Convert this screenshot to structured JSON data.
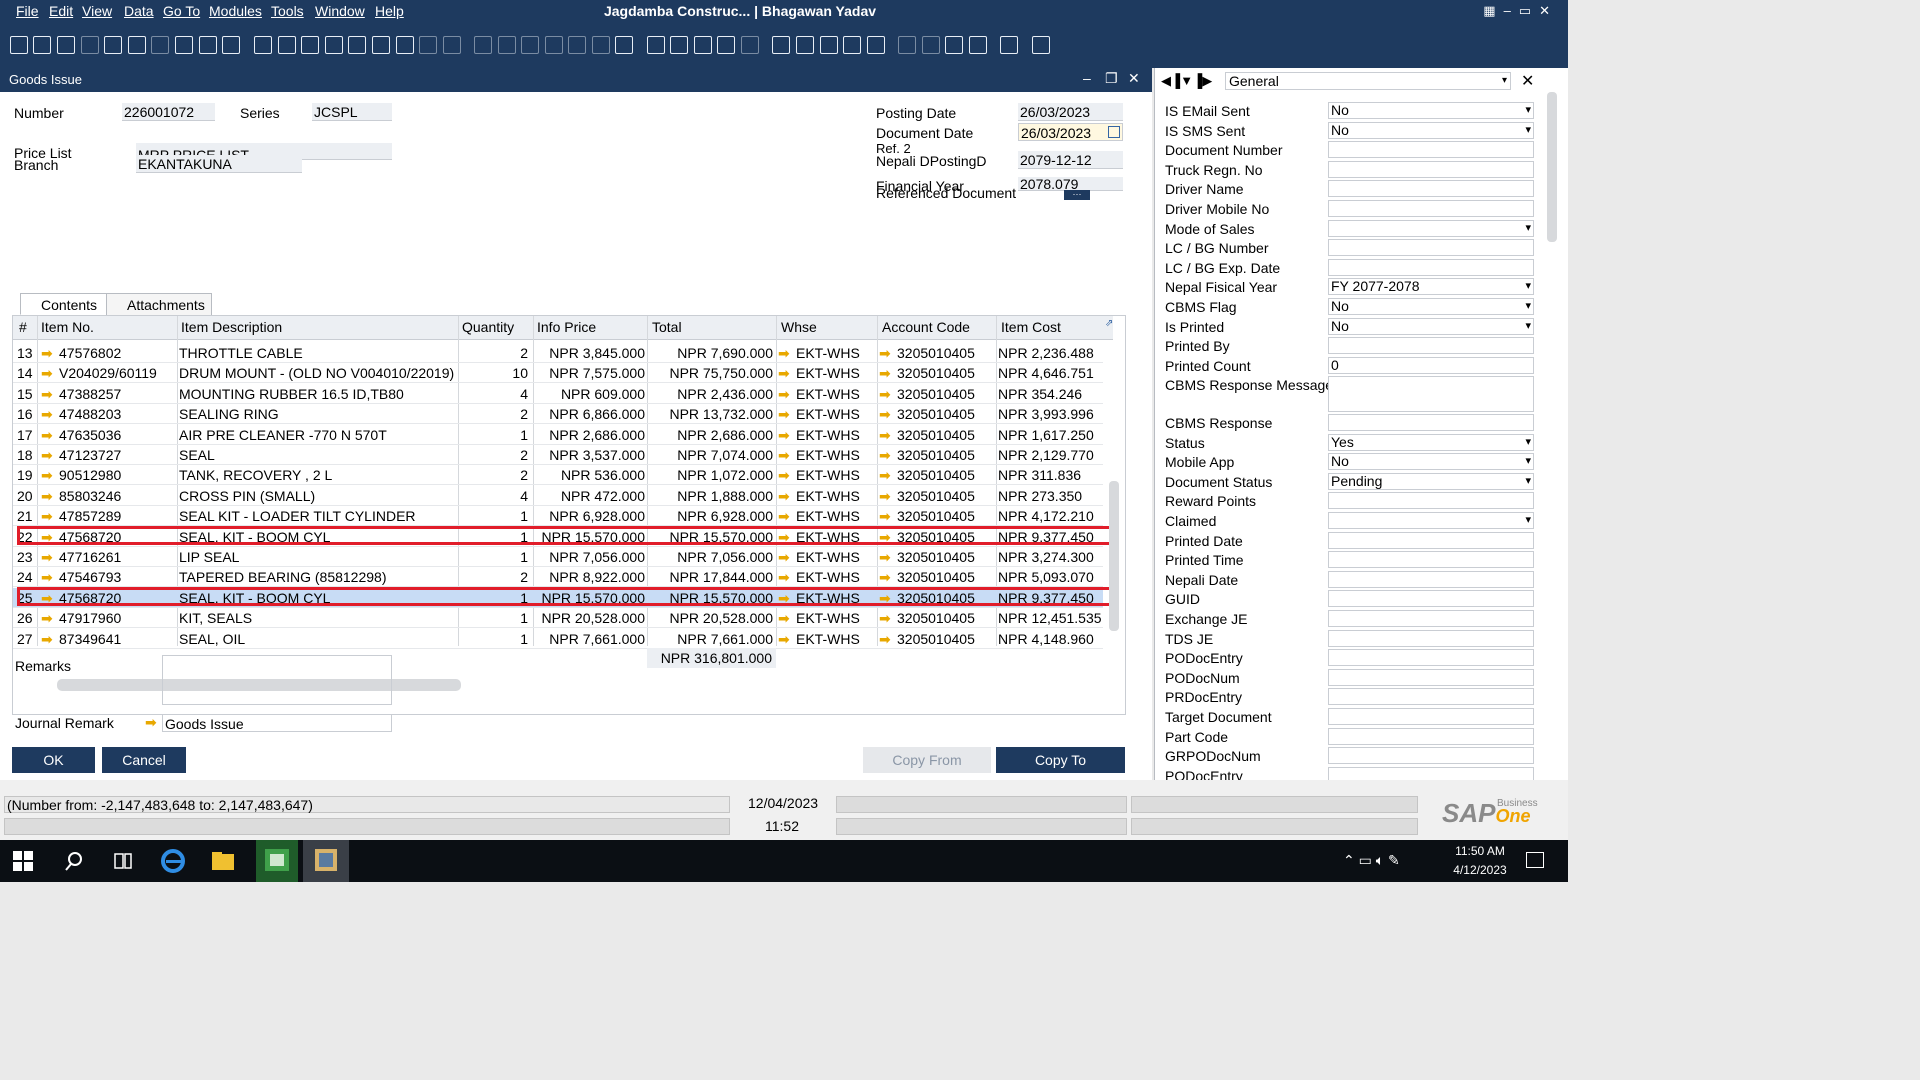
{
  "menu": [
    "File",
    "Edit",
    "View",
    "Data",
    "Go To",
    "Modules",
    "Tools",
    "Window",
    "Help"
  ],
  "app_title": "Jagdamba Construc... | Bhagawan Yadav",
  "window_title": "Goods Issue",
  "header": {
    "number_label": "Number",
    "number": "226001072",
    "series_label": "Series",
    "series": "JCSPL",
    "price_list_label": "Price List",
    "price_list": "MRP PRICE LIST",
    "branch_label": "Branch",
    "branch": "EKANTAKUNA",
    "posting_date_label": "Posting Date",
    "posting_date": "26/03/2023",
    "document_date_label": "Document Date",
    "document_date": "26/03/2023",
    "ref2_label": "Ref. 2",
    "nepali_label": "Nepali DPostingD",
    "nepali_date": "2079-12-12",
    "fin_year_label": "Financial Year",
    "ref_doc_label": "Referenced Document",
    "fin_year": "2078.079"
  },
  "tabs": [
    "Contents",
    "Attachments"
  ],
  "columns": [
    "#",
    "Item No.",
    "Item Description",
    "Quantity",
    "Info Price",
    "Total",
    "Whse",
    "Account Code",
    "Item Cost"
  ],
  "rows": [
    [
      "13",
      "47576802",
      "THROTTLE CABLE",
      "2",
      "NPR 3,845.000",
      "NPR 7,690.000",
      "EKT-WHS",
      "3205010405",
      "NPR 2,236.488"
    ],
    [
      "14",
      "V204029/60119",
      "DRUM MOUNT - (OLD NO V004010/22019)",
      "10",
      "NPR 7,575.000",
      "NPR 75,750.000",
      "EKT-WHS",
      "3205010405",
      "NPR 4,646.751"
    ],
    [
      "15",
      "47388257",
      "MOUNTING RUBBER 16.5 ID,TB80",
      "4",
      "NPR 609.000",
      "NPR 2,436.000",
      "EKT-WHS",
      "3205010405",
      "NPR 354.246"
    ],
    [
      "16",
      "47488203",
      "SEALING RING",
      "2",
      "NPR 6,866.000",
      "NPR 13,732.000",
      "EKT-WHS",
      "3205010405",
      "NPR 3,993.996"
    ],
    [
      "17",
      "47635036",
      "AIR PRE CLEANER -770 N 570T",
      "1",
      "NPR 2,686.000",
      "NPR 2,686.000",
      "EKT-WHS",
      "3205010405",
      "NPR 1,617.250"
    ],
    [
      "18",
      "47123727",
      "SEAL",
      "2",
      "NPR 3,537.000",
      "NPR 7,074.000",
      "EKT-WHS",
      "3205010405",
      "NPR 2,129.770"
    ],
    [
      "19",
      "90512980",
      "TANK, RECOVERY , 2 L",
      "2",
      "NPR 536.000",
      "NPR 1,072.000",
      "EKT-WHS",
      "3205010405",
      "NPR 311.836"
    ],
    [
      "20",
      "85803246",
      "CROSS PIN (SMALL)",
      "4",
      "NPR 472.000",
      "NPR 1,888.000",
      "EKT-WHS",
      "3205010405",
      "NPR 273.350"
    ],
    [
      "21",
      "47857289",
      "SEAL KIT - LOADER TILT CYLINDER",
      "1",
      "NPR 6,928.000",
      "NPR 6,928.000",
      "EKT-WHS",
      "3205010405",
      "NPR 4,172.210"
    ],
    [
      "22",
      "47568720",
      "SEAL, KIT - BOOM CYL",
      "1",
      "NPR 15,570.000",
      "NPR 15,570.000",
      "EKT-WHS",
      "3205010405",
      "NPR 9,377.450"
    ],
    [
      "23",
      "47716261",
      "LIP SEAL",
      "1",
      "NPR 7,056.000",
      "NPR 7,056.000",
      "EKT-WHS",
      "3205010405",
      "NPR 3,274.300"
    ],
    [
      "24",
      "47546793",
      "TAPERED BEARING (85812298)",
      "2",
      "NPR 8,922.000",
      "NPR 17,844.000",
      "EKT-WHS",
      "3205010405",
      "NPR 5,093.070"
    ],
    [
      "25",
      "47568720",
      "SEAL, KIT - BOOM CYL",
      "1",
      "NPR 15,570.000",
      "NPR 15,570.000",
      "EKT-WHS",
      "3205010405",
      "NPR 9,377.450"
    ],
    [
      "26",
      "47917960",
      "KIT, SEALS",
      "1",
      "NPR 20,528.000",
      "NPR 20,528.000",
      "EKT-WHS",
      "3205010405",
      "NPR 12,451.535"
    ],
    [
      "27",
      "87349641",
      "SEAL, OIL",
      "1",
      "NPR 7,661.000",
      "NPR 7,661.000",
      "EKT-WHS",
      "3205010405",
      "NPR 4,148.960"
    ]
  ],
  "total": "NPR 316,801.000",
  "footer": {
    "remarks_label": "Remarks",
    "journal_label": "Journal Remark",
    "journal": "Goods Issue",
    "ok": "OK",
    "cancel": "Cancel",
    "copy_from": "Copy From",
    "copy_to": "Copy To"
  },
  "udf": {
    "dropdown": "General",
    "fields": [
      [
        "IS EMail Sent",
        "No",
        true
      ],
      [
        "IS SMS Sent",
        "No",
        true
      ],
      [
        "Document Number",
        "",
        false
      ],
      [
        "Truck Regn. No",
        "",
        false
      ],
      [
        "Driver Name",
        "",
        false
      ],
      [
        "Driver Mobile No",
        "",
        false
      ],
      [
        "Mode of Sales",
        "",
        true
      ],
      [
        "LC / BG Number",
        "",
        false
      ],
      [
        "LC / BG Exp. Date",
        "",
        false
      ],
      [
        "Nepal Fisical Year",
        "FY 2077-2078",
        true
      ],
      [
        "CBMS Flag",
        "No",
        true
      ],
      [
        "Is Printed",
        "No",
        true
      ],
      [
        "Printed By",
        "",
        false
      ],
      [
        "Printed Count",
        "0",
        false
      ],
      [
        "CBMS Response Message",
        "",
        false
      ],
      [
        "CBMS Response",
        "",
        false
      ],
      [
        "Status",
        "Yes",
        true
      ],
      [
        "Mobile App",
        "No",
        true
      ],
      [
        "Document Status",
        "Pending",
        true
      ],
      [
        "Reward Points",
        "",
        false
      ],
      [
        "Claimed",
        "",
        true
      ],
      [
        "Printed Date",
        "",
        false
      ],
      [
        "Printed Time",
        "",
        false
      ],
      [
        "Nepali Date",
        "",
        false
      ],
      [
        "GUID",
        "",
        false
      ],
      [
        "Exchange JE",
        "",
        false
      ],
      [
        "TDS JE",
        "",
        false
      ],
      [
        "PODocEntry",
        "",
        false
      ],
      [
        "PODocNum",
        "",
        false
      ],
      [
        "PRDocEntry",
        "",
        false
      ],
      [
        "Target Document",
        "",
        false
      ],
      [
        "Part Code",
        "",
        false
      ],
      [
        "GRPODocNum",
        "",
        false
      ],
      [
        "PODocEntry",
        "",
        false
      ]
    ]
  },
  "status": {
    "message": "(Number from: -2,147,483,648 to: 2,147,483,647)",
    "date": "12/04/2023",
    "time": "11:52",
    "logo": "SAP",
    "logo_sub": "Business",
    "logo_one": "One"
  },
  "taskbar": {
    "time": "11:50 AM",
    "date": "4/12/2023"
  }
}
